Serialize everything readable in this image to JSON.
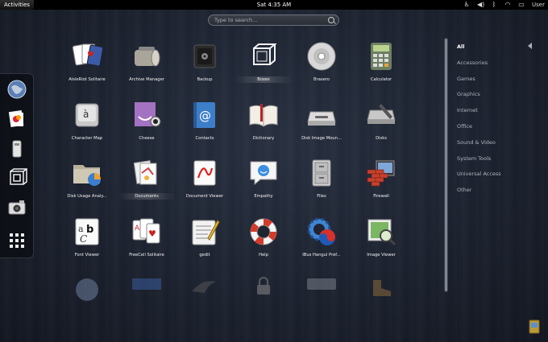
{
  "topbar": {
    "activities": "Activities",
    "clock": "Sat  4:35 AM",
    "user": "User"
  },
  "search": {
    "placeholder": "Type to search..."
  },
  "apps": [
    {
      "label": "AisleRiot Solitaire"
    },
    {
      "label": "Archive Manager"
    },
    {
      "label": "Backup"
    },
    {
      "label": "Boxes"
    },
    {
      "label": "Brasero"
    },
    {
      "label": "Calculator"
    },
    {
      "label": "Character Map"
    },
    {
      "label": "Cheese"
    },
    {
      "label": "Contacts"
    },
    {
      "label": "Dictionary"
    },
    {
      "label": "Disk Image Moun..."
    },
    {
      "label": "Disks"
    },
    {
      "label": "Disk Usage Analy..."
    },
    {
      "label": "Documents"
    },
    {
      "label": "Document Viewer"
    },
    {
      "label": "Empathy"
    },
    {
      "label": "Files"
    },
    {
      "label": "Firewall"
    },
    {
      "label": "Font Viewer"
    },
    {
      "label": "FreeCell Solitaire"
    },
    {
      "label": "gedit"
    },
    {
      "label": "Help"
    },
    {
      "label": "IBus Hangul Pref..."
    },
    {
      "label": "Image Viewer"
    }
  ],
  "categories": [
    {
      "label": "All"
    },
    {
      "label": "Accessories"
    },
    {
      "label": "Games"
    },
    {
      "label": "Graphics"
    },
    {
      "label": "Internet"
    },
    {
      "label": "Office"
    },
    {
      "label": "Sound & Video"
    },
    {
      "label": "System Tools"
    },
    {
      "label": "Universal Access"
    },
    {
      "label": "Other"
    }
  ]
}
